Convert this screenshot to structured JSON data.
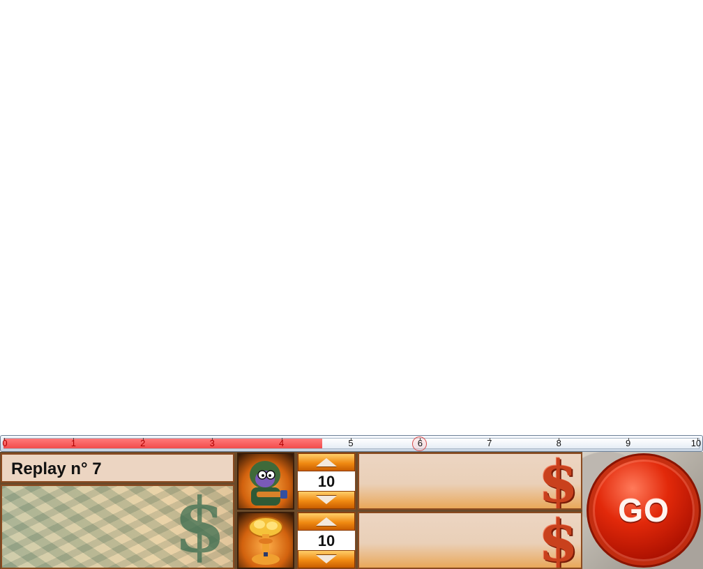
{
  "timeline": {
    "ticks": [
      "0",
      "1",
      "2",
      "3",
      "4",
      "5",
      "6",
      "7",
      "8",
      "9",
      "10"
    ],
    "progress_value": 4.6,
    "range": [
      0,
      10
    ],
    "marker_value": 6
  },
  "replay": {
    "label": "Replay n° 7"
  },
  "units": [
    {
      "icon": "soldier-icon",
      "count": "10"
    },
    {
      "icon": "mushroom-cloud-icon",
      "count": "10"
    }
  ],
  "go_button": {
    "label": "GO"
  },
  "colors": {
    "progress": "#f24c4c",
    "panel_bg": "#ecd5c2",
    "accent_orange": "#f08a12",
    "go_red": "#e2290a",
    "dollar_red": "#c9411d"
  }
}
